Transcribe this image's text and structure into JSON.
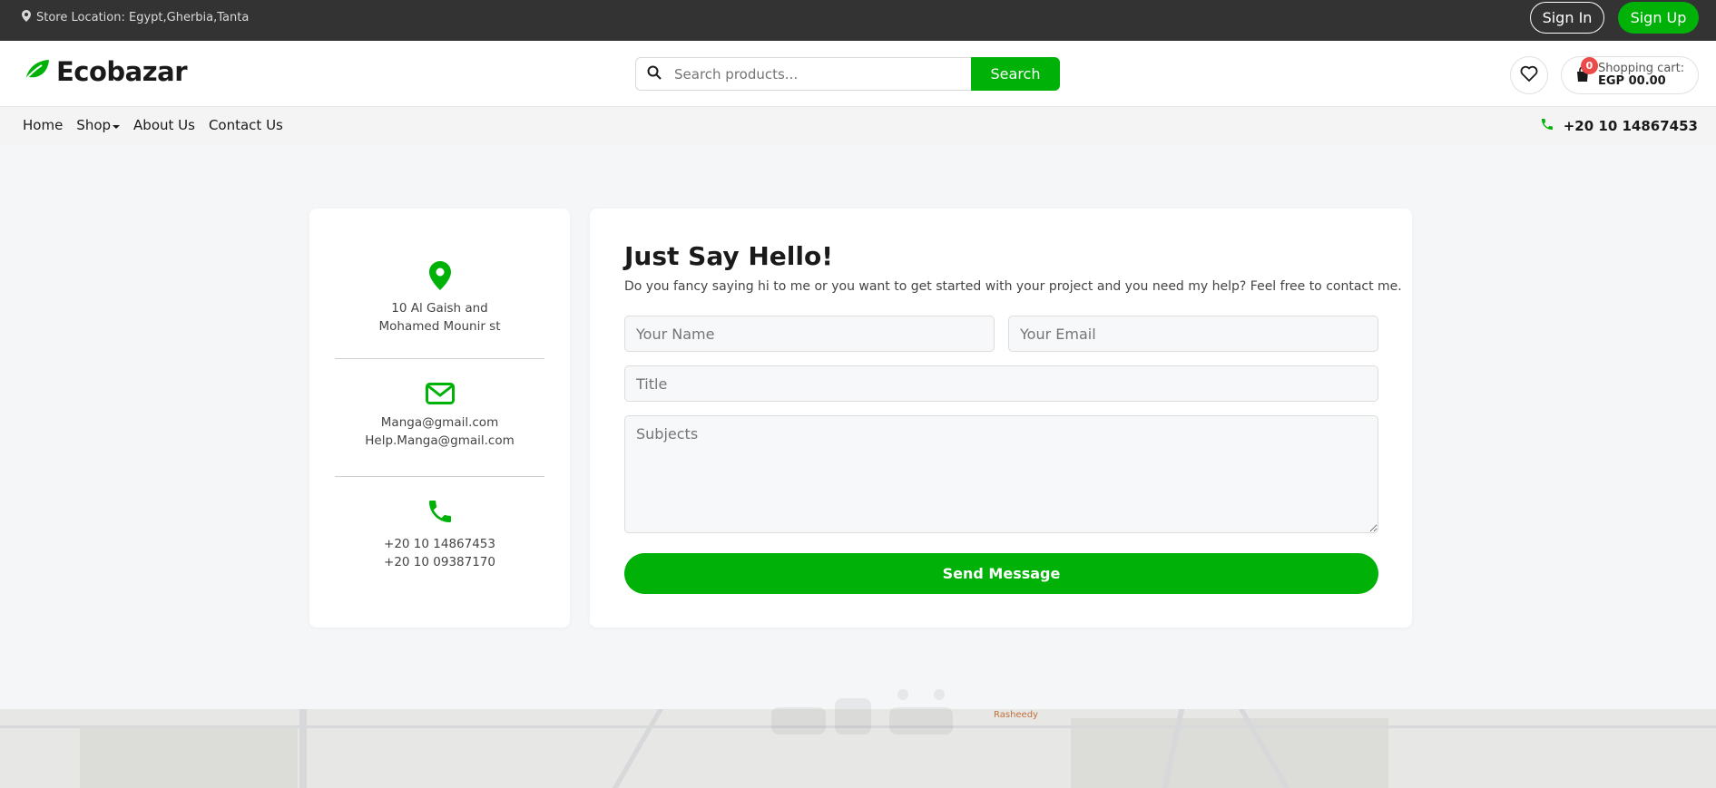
{
  "topbar": {
    "location": "Store Location: Egypt,Gherbia,Tanta",
    "sign_in": "Sign In",
    "sign_up": "Sign Up"
  },
  "header": {
    "logo": "Ecobazar",
    "search_placeholder": "Search products...",
    "search_button": "Search",
    "cart_count": "0",
    "cart_label": "Shopping cart:",
    "cart_total": "EGP 00.00"
  },
  "nav": {
    "items": [
      "Home",
      "Shop",
      "About Us",
      "Contact Us"
    ],
    "phone": "+20 10 14867453"
  },
  "contact_info": {
    "address_line1": "10 Al Gaish and",
    "address_line2": "Mohamed Mounir st",
    "email1": "Manga@gmail.com",
    "email2": "Help.Manga@gmail.com",
    "phone1": "+20 10 14867453",
    "phone2": "+20 10 09387170"
  },
  "form": {
    "title": "Just Say Hello!",
    "subtitle": "Do you fancy saying hi to me or you want to get started with your project and you need my help? Feel free to contact me.",
    "name_placeholder": "Your Name",
    "email_placeholder": "Your Email",
    "title_placeholder": "Title",
    "subjects_placeholder": "Subjects",
    "send_button": "Send Message"
  },
  "map": {
    "poi_label": "Rasheedy"
  },
  "colors": {
    "brand_green": "#00b207",
    "topbar_bg": "#333333",
    "badge_red": "#ea4b48"
  }
}
